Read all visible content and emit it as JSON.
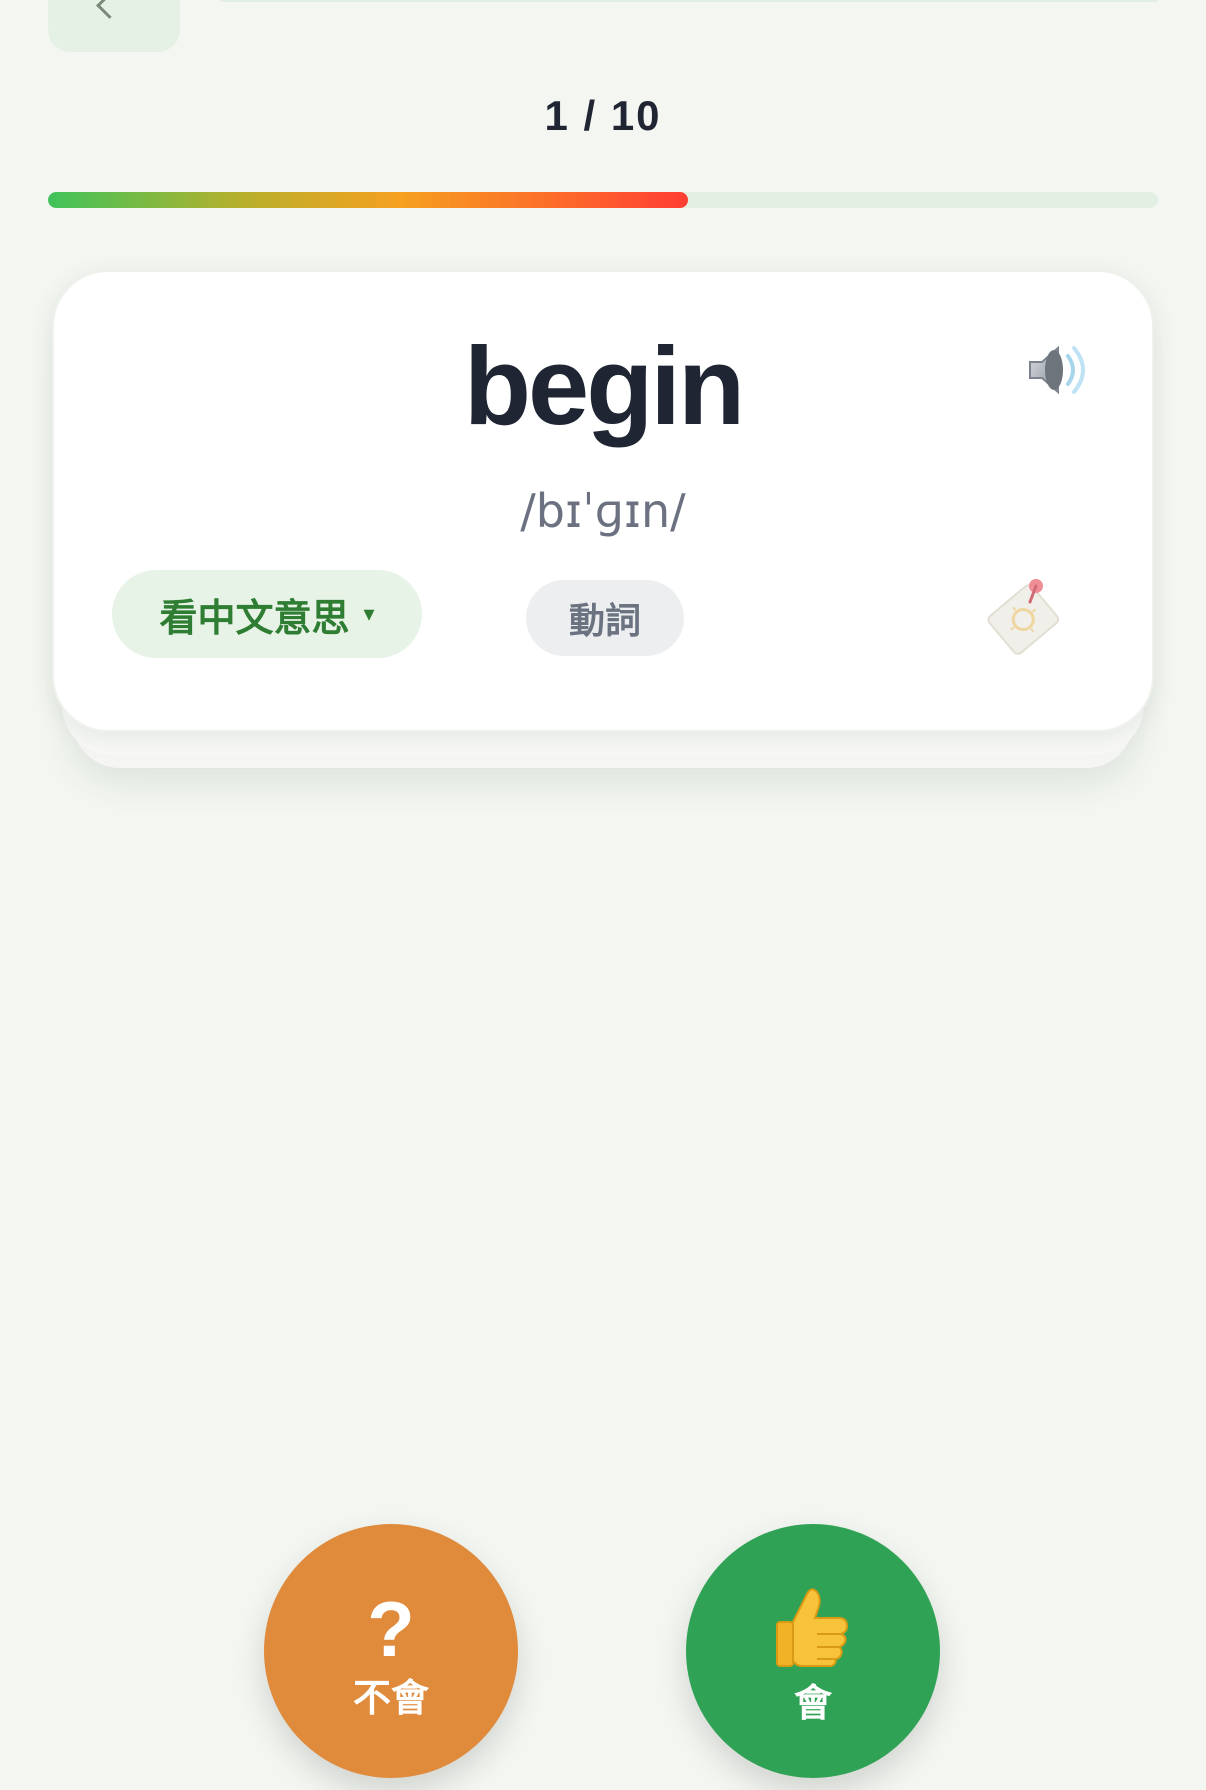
{
  "header": {
    "progress_text": "1 / 10",
    "progress_fraction": 0.577
  },
  "card": {
    "word": "begin",
    "phonetic": "/bɪˈɡɪn/",
    "meaning_button": "看中文意思",
    "meaning_caret": "▾",
    "part_of_speech": "動詞",
    "speaker_icon": "speaker-icon",
    "bookmark_icon": "bookmark-pin-icon"
  },
  "actions": {
    "unknown_symbol": "?",
    "unknown_label": "不會",
    "known_icon": "thumbs-up-icon",
    "known_label": "會"
  },
  "colors": {
    "background": "#f3f6f1",
    "primary_text": "#1f2533",
    "meaning_green": "#2e7d32",
    "unknown_orange": "#e08a3c",
    "known_green": "#30a255"
  }
}
